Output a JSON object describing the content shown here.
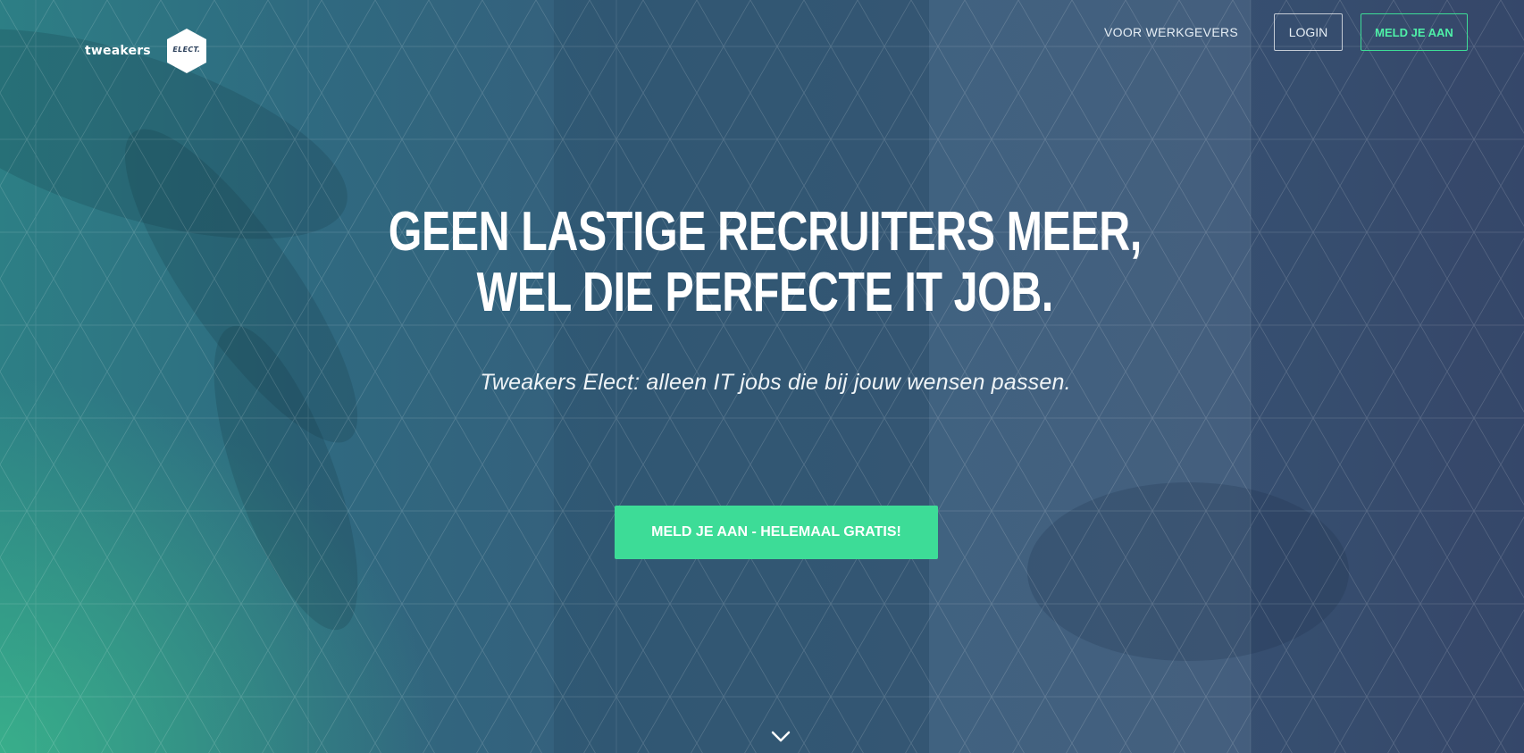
{
  "brand": {
    "name": "tweakers",
    "badge": "ELECT."
  },
  "nav": {
    "employers": "VOOR WERKGEVERS",
    "login": "LOGIN",
    "signup": "MELD JE AAN"
  },
  "hero": {
    "headline_line1": "Geen lastige recruiters meer,",
    "headline_line2": "wel die perfecte IT job.",
    "subtitle": "Tweakers Elect: alleen IT jobs die bij jouw wensen passen.",
    "cta": "MELD JE AAN - HELEMAAL GRATIS!"
  },
  "icons": {
    "scroll": "chevron-down-icon",
    "badge": "hexagon-icon"
  },
  "colors": {
    "accent": "#3ddc97",
    "overlay_blue": "#3a5d7c",
    "overlay_green": "#2d8a86"
  }
}
